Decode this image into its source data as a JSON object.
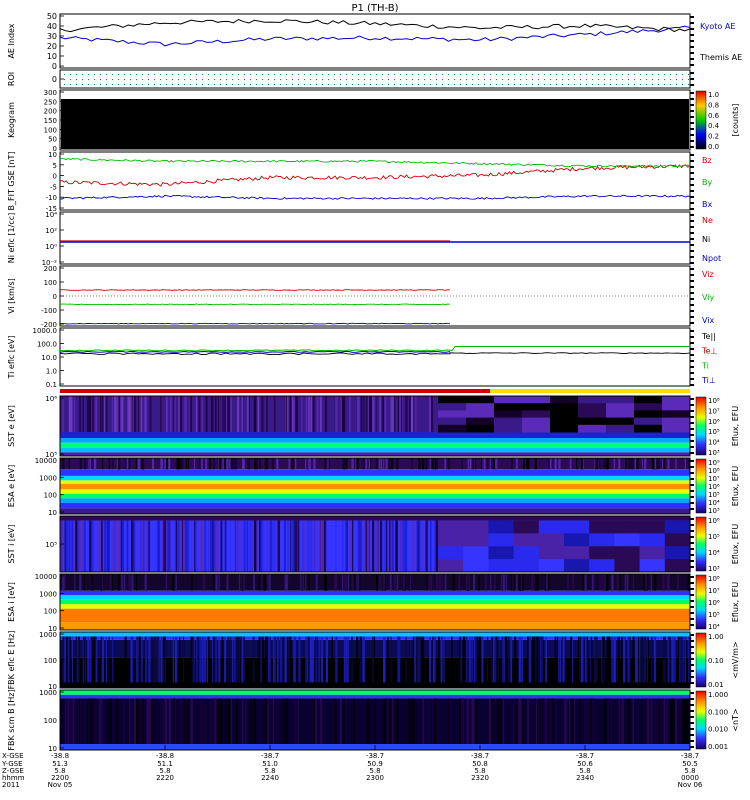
{
  "title": "P1 (TH-B)",
  "colors": {
    "kyoto": "#0000cc",
    "themis": "#000000",
    "bz": "#cc0000",
    "by": "#00bb00",
    "bx": "#0000cc",
    "ne": "#cc0000",
    "ni": "#000000",
    "npot": "#0000cc",
    "vix": "#cc0000",
    "viy": "#00bb00",
    "viz": "#0000cc",
    "tepar": "#000000",
    "teperp": "#cc0000",
    "ti": "#00bb00",
    "tiperp": "#0000cc"
  },
  "panels": {
    "ae": {
      "ylabel": "AE Index",
      "ticks": [
        "50",
        "40",
        "30",
        "20",
        "10",
        "0"
      ],
      "legend": [
        "Kyoto AE",
        "Themis AE"
      ]
    },
    "roi": {
      "ylabel": "ROI",
      "ticks": [
        "0"
      ]
    },
    "keogram": {
      "ylabel": "Keogram",
      "ticks": [
        "300",
        "250",
        "200",
        "150",
        "100",
        "50",
        "0"
      ],
      "cb_ticks": [
        "1.0",
        "0.8",
        "0.6",
        "0.4",
        "0.2",
        "0.0"
      ],
      "cb_label": "[counts]"
    },
    "bfield": {
      "ylabel": "B_FIT GSE [nT]",
      "ticks": [
        "10",
        "5",
        "0",
        "-5",
        "-10",
        "-15"
      ],
      "legend": [
        "Bz",
        "By",
        "Bx"
      ]
    },
    "density": {
      "ylabel": "Ni eflc [1/cc]",
      "ticks": [
        "10⁴",
        "10²",
        "10⁰",
        "10⁻²"
      ],
      "legend": [
        "Ne",
        "Ni",
        "Npot"
      ]
    },
    "velocity": {
      "ylabel": "Vi [km/s]",
      "ticks": [
        "200",
        "100",
        "0",
        "-100",
        "-200"
      ],
      "legend": [
        "Viz",
        "Viy",
        "Vix"
      ]
    },
    "temp": {
      "ylabel": "Ti eflc [eV]",
      "ticks": [
        "1000.0",
        "100.0",
        "10.0",
        "1.0",
        "0.1"
      ],
      "legend": [
        "Te||",
        "Te⊥",
        "Ti",
        "Ti⊥"
      ]
    },
    "sst_e": {
      "ylabel": "SST e [eV]",
      "ticks": [
        "10⁶",
        "10⁵"
      ],
      "cb_ticks": [
        "10⁸",
        "10⁷",
        "10⁶",
        "10⁵",
        "10⁴",
        "10³"
      ],
      "cb_label": "Eflux, EFU"
    },
    "esa_e": {
      "ylabel": "ESA e [eV]",
      "ticks": [
        "10000",
        "1000",
        "100",
        "10"
      ],
      "cb_ticks": [
        "10⁹",
        "10⁸",
        "10⁷",
        "10⁶",
        "10⁵",
        "10⁴",
        "10³"
      ],
      "cb_label": "Eflux, EFU"
    },
    "sst_i": {
      "ylabel": "SST i [eV]",
      "ticks": [
        "10⁵"
      ],
      "cb_ticks": [
        "10⁶",
        "10⁵",
        "10⁴",
        "10³"
      ],
      "cb_label": "Eflux, EFU"
    },
    "esa_i": {
      "ylabel": "ESA i [eV]",
      "ticks": [
        "10000",
        "1000",
        "100",
        "10"
      ],
      "cb_ticks": [
        "10⁸",
        "10⁷",
        "10⁶",
        "10⁵",
        "10⁴"
      ],
      "cb_label": "Eflux, EFU"
    },
    "fbk_e": {
      "ylabel": "FBK eflc E [Hz]",
      "ticks": [
        "1000",
        "100",
        "10"
      ],
      "cb_ticks": [
        "1.00",
        "0.10",
        "0.01"
      ],
      "cb_label": "<mV/m>"
    },
    "fbk_b": {
      "ylabel": "FBK scm B [Hz]",
      "ticks": [
        "1000",
        "100",
        "10"
      ],
      "cb_ticks": [
        "1.000",
        "0.100",
        "0.010",
        "0.001"
      ],
      "cb_label": "<nT>"
    }
  },
  "xaxis": {
    "row_labels": [
      "X-GSE",
      "Y-GSE",
      "Z-GSE",
      "hhmm",
      "2011"
    ],
    "ticks": [
      {
        "x": "-38.8",
        "y": "51.3",
        "z": "5.8",
        "t": "2200",
        "d": "Nov 05"
      },
      {
        "x": "-38.8",
        "y": "51.1",
        "z": "5.8",
        "t": "2220",
        "d": ""
      },
      {
        "x": "-38.7",
        "y": "51.0",
        "z": "5.8",
        "t": "2240",
        "d": ""
      },
      {
        "x": "-38.7",
        "y": "50.9",
        "z": "5.8",
        "t": "2300",
        "d": ""
      },
      {
        "x": "-38.7",
        "y": "50.8",
        "z": "5.8",
        "t": "2320",
        "d": ""
      },
      {
        "x": "-38.7",
        "y": "50.6",
        "z": "5.8",
        "t": "2340",
        "d": ""
      },
      {
        "x": "-38.7",
        "y": "50.5",
        "z": "5.8",
        "t": "0000",
        "d": "Nov 06"
      }
    ]
  },
  "chart_data": [
    {
      "type": "line",
      "title": "AE Index",
      "ylim": [
        0,
        50
      ],
      "x": [
        "2200",
        "2220",
        "2240",
        "2300",
        "2320",
        "2340",
        "0000"
      ],
      "series": [
        {
          "name": "Kyoto AE",
          "values": [
            28,
            22,
            27,
            28,
            26,
            31,
            37
          ]
        },
        {
          "name": "Themis AE",
          "values": [
            35,
            42,
            44,
            41,
            37,
            39,
            35
          ]
        }
      ]
    },
    {
      "type": "line",
      "title": "B_FIT GSE",
      "ylim": [
        -15,
        10
      ],
      "x": [
        "2200",
        "2220",
        "2240",
        "2300",
        "2320",
        "2340",
        "0000"
      ],
      "series": [
        {
          "name": "Bz",
          "values": [
            -3,
            -4,
            -1,
            -1,
            0,
            3,
            4
          ]
        },
        {
          "name": "By",
          "values": [
            7,
            6,
            6,
            6,
            5,
            4,
            4
          ]
        },
        {
          "name": "Bx",
          "values": [
            -10,
            -9,
            -10,
            -10,
            -10,
            -9,
            -9
          ]
        }
      ]
    },
    {
      "type": "line",
      "title": "Vi",
      "ylim": [
        -250,
        250
      ],
      "x": [
        "2200",
        "2220",
        "2240",
        "2300",
        "2320"
      ],
      "series": [
        {
          "name": "Viz",
          "values": [
            50,
            50,
            50,
            50,
            50
          ]
        },
        {
          "name": "Viy",
          "values": [
            -70,
            -70,
            -70,
            -70,
            -70
          ]
        },
        {
          "name": "Vix",
          "values": [
            -230,
            -230,
            -230,
            -230,
            -230
          ]
        }
      ]
    },
    {
      "type": "line",
      "title": "Ti",
      "ylim": [
        0.1,
        1000
      ],
      "x": [
        "2200",
        "2220",
        "2240",
        "2300",
        "2320",
        "2340",
        "0000"
      ],
      "series": [
        {
          "name": "Ti",
          "values": [
            25,
            25,
            25,
            25,
            60,
            60,
            60
          ]
        },
        {
          "name": "Ti⊥",
          "values": [
            20,
            20,
            20,
            20,
            20,
            20,
            20
          ]
        }
      ]
    }
  ]
}
